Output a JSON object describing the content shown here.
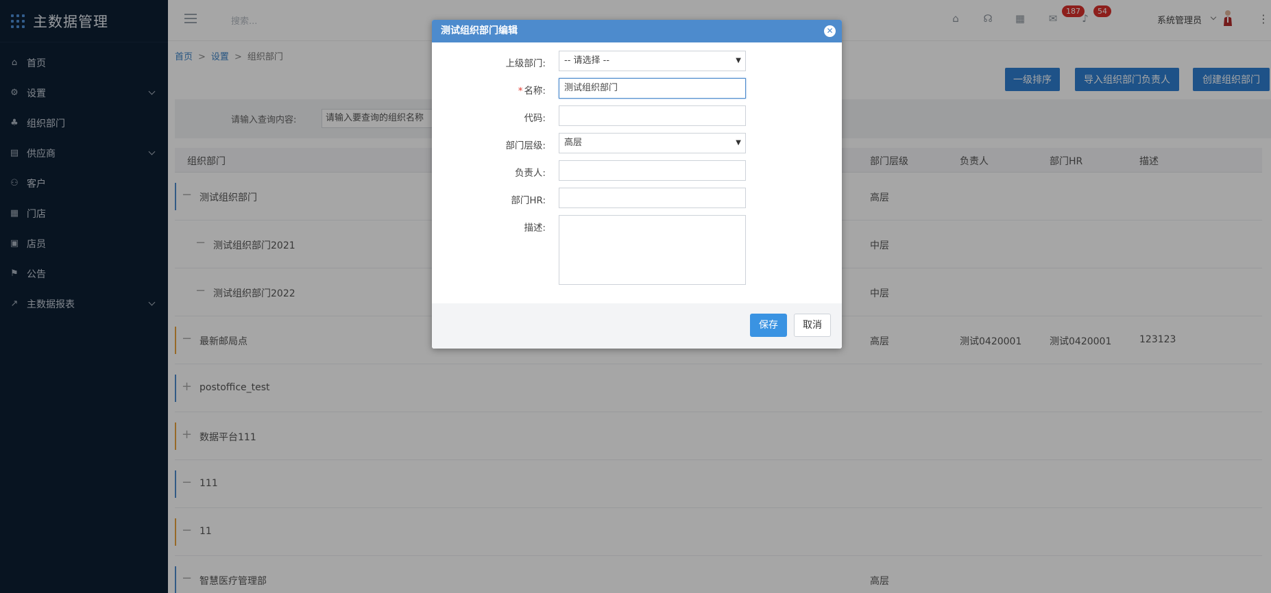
{
  "app": {
    "title": "主数据管理"
  },
  "sidebar": {
    "items": [
      {
        "label": "首页",
        "icon": "home-icon"
      },
      {
        "label": "设置",
        "icon": "gear-icon",
        "expandable": true
      },
      {
        "label": "组织部门",
        "icon": "org-icon"
      },
      {
        "label": "供应商",
        "icon": "supplier-icon",
        "expandable": true
      },
      {
        "label": "客户",
        "icon": "customer-icon"
      },
      {
        "label": "门店",
        "icon": "store-icon"
      },
      {
        "label": "店员",
        "icon": "clerk-icon"
      },
      {
        "label": "公告",
        "icon": "notice-icon"
      },
      {
        "label": "主数据报表",
        "icon": "report-icon",
        "expandable": true
      }
    ]
  },
  "topbar": {
    "search_placeholder": "搜索...",
    "badge_messages": "187",
    "badge_notifications": "54",
    "user_name": "系统管理员"
  },
  "breadcrumb": {
    "home": "首页",
    "settings": "设置",
    "current": "组织部门"
  },
  "actions": {
    "sort_label": "一级排序",
    "import_label": "导入组织部门负责人",
    "create_label": "创建组织部门"
  },
  "filter": {
    "label": "请输入查询内容:",
    "placeholder": "请输入要查询的组织名称"
  },
  "table": {
    "headers": [
      "组织部门",
      "部门层级",
      "负责人",
      "部门HR",
      "描述"
    ],
    "rows": [
      {
        "name": "测试组织部门",
        "level": "高层",
        "owner": "",
        "hr": "",
        "desc": "",
        "toggle": "−",
        "bar": "#4d8bcd",
        "indent": 0
      },
      {
        "name": "测试组织部门2021",
        "level": "中层",
        "owner": "",
        "hr": "",
        "desc": "",
        "toggle": "−",
        "bar": "",
        "indent": 1
      },
      {
        "name": "测试组织部门2022",
        "level": "中层",
        "owner": "",
        "hr": "",
        "desc": "",
        "toggle": "−",
        "bar": "",
        "indent": 1
      },
      {
        "name": "最新邮局点",
        "level": "高层",
        "owner": "测试0420001",
        "hr": "测试0420001",
        "desc": "123123",
        "toggle": "−",
        "bar": "#e8a23c",
        "indent": 0
      },
      {
        "name": "postoffice_test",
        "level": "",
        "owner": "",
        "hr": "",
        "desc": "",
        "toggle": "+",
        "bar": "#4d8bcd",
        "indent": 0
      },
      {
        "name": "数据平台111",
        "level": "",
        "owner": "",
        "hr": "",
        "desc": "",
        "toggle": "+",
        "bar": "#e8a23c",
        "indent": 0
      },
      {
        "name": "111",
        "level": "",
        "owner": "",
        "hr": "",
        "desc": "",
        "toggle": "−",
        "bar": "#4d8bcd",
        "indent": 0
      },
      {
        "name": "11",
        "level": "",
        "owner": "",
        "hr": "",
        "desc": "",
        "toggle": "−",
        "bar": "#e8a23c",
        "indent": 0
      },
      {
        "name": "智慧医疗管理部",
        "level": "高层",
        "owner": "",
        "hr": "",
        "desc": "",
        "toggle": "−",
        "bar": "#4d8bcd",
        "indent": 0
      }
    ]
  },
  "modal": {
    "title": "测试组织部门编辑",
    "fields": {
      "parent": {
        "label": "上级部门:",
        "value": "-- 请选择 --"
      },
      "name": {
        "label": "名称:",
        "value": "测试组织部门",
        "required_mark": "*"
      },
      "code": {
        "label": "代码:",
        "value": ""
      },
      "level": {
        "label": "部门层级:",
        "value": "高层"
      },
      "owner": {
        "label": "负责人:",
        "value": ""
      },
      "hr": {
        "label": "部门HR:",
        "value": ""
      },
      "desc": {
        "label": "描述:",
        "value": ""
      }
    },
    "save_label": "保存",
    "cancel_label": "取消"
  },
  "colors": {
    "sidebar_bg": "#0d1f33",
    "primary": "#2f7fd1",
    "modal_header": "#4d8bcd",
    "badge": "#d9302c"
  }
}
